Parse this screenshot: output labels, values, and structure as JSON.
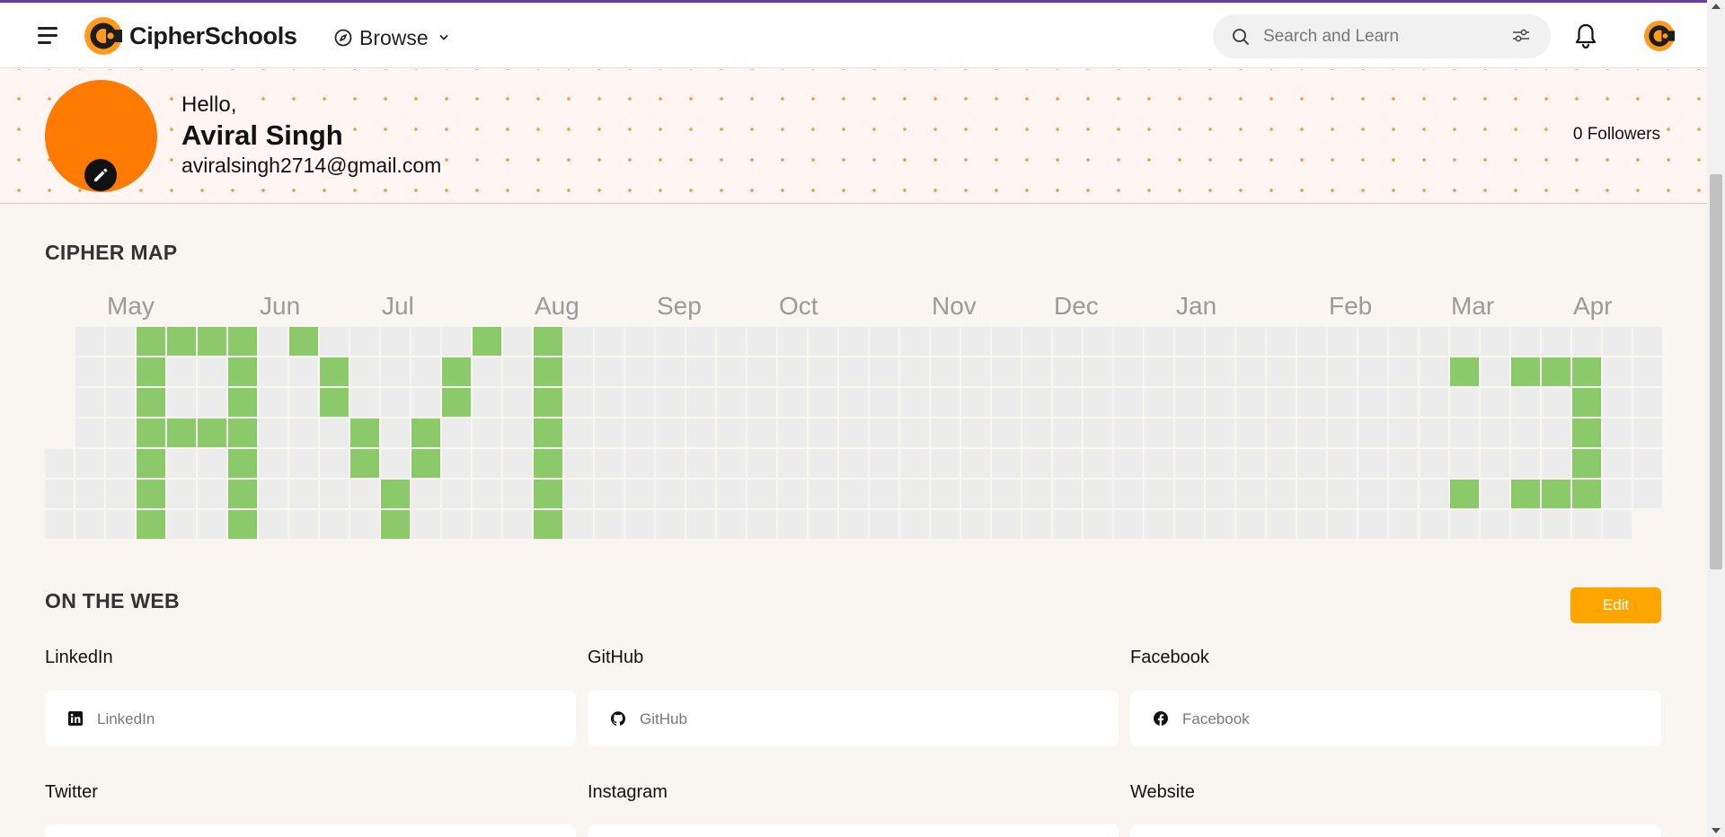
{
  "header": {
    "logo_text": "CipherSchools",
    "browse_label": "Browse",
    "search_placeholder": "Search and Learn"
  },
  "profile": {
    "greeting": "Hello,",
    "name": "Aviral Singh",
    "email": "aviralsingh2714@gmail.com",
    "followers": "0 Followers"
  },
  "cipher_map": {
    "title": "CIPHER MAP",
    "months": [
      "May",
      "Jun",
      "Jul",
      "Aug",
      "Sep",
      "Oct",
      "Nov",
      "Dec",
      "Jan",
      "Feb",
      "Mar",
      "Apr"
    ],
    "weeks": 53,
    "first_week_start_day": 4,
    "last_week_end_day": 5,
    "active": [
      [
        3,
        0
      ],
      [
        4,
        0
      ],
      [
        5,
        0
      ],
      [
        6,
        0
      ],
      [
        8,
        0
      ],
      [
        14,
        0
      ],
      [
        16,
        0
      ],
      [
        3,
        1
      ],
      [
        6,
        1
      ],
      [
        9,
        1
      ],
      [
        13,
        1
      ],
      [
        16,
        1
      ],
      [
        46,
        1
      ],
      [
        48,
        1
      ],
      [
        49,
        1
      ],
      [
        50,
        1
      ],
      [
        3,
        2
      ],
      [
        6,
        2
      ],
      [
        9,
        2
      ],
      [
        13,
        2
      ],
      [
        16,
        2
      ],
      [
        50,
        2
      ],
      [
        3,
        3
      ],
      [
        4,
        3
      ],
      [
        5,
        3
      ],
      [
        6,
        3
      ],
      [
        10,
        3
      ],
      [
        12,
        3
      ],
      [
        16,
        3
      ],
      [
        50,
        3
      ],
      [
        3,
        4
      ],
      [
        6,
        4
      ],
      [
        10,
        4
      ],
      [
        12,
        4
      ],
      [
        16,
        4
      ],
      [
        50,
        4
      ],
      [
        3,
        5
      ],
      [
        6,
        5
      ],
      [
        11,
        5
      ],
      [
        16,
        5
      ],
      [
        46,
        5
      ],
      [
        48,
        5
      ],
      [
        49,
        5
      ],
      [
        50,
        5
      ],
      [
        3,
        6
      ],
      [
        6,
        6
      ],
      [
        11,
        6
      ],
      [
        16,
        6
      ]
    ],
    "colors": {
      "active": "#8bc96a",
      "inactive": "#ececec"
    }
  },
  "on_the_web": {
    "title": "ON THE WEB",
    "edit_label": "Edit",
    "fields": [
      {
        "label": "LinkedIn",
        "placeholder": "LinkedIn",
        "icon": "linkedin-icon"
      },
      {
        "label": "GitHub",
        "placeholder": "GitHub",
        "icon": "github-icon"
      },
      {
        "label": "Facebook",
        "placeholder": "Facebook",
        "icon": "facebook-icon"
      },
      {
        "label": "Twitter",
        "placeholder": "",
        "icon": "twitter-icon"
      },
      {
        "label": "Instagram",
        "placeholder": "",
        "icon": "instagram-icon"
      },
      {
        "label": "Website",
        "placeholder": "",
        "icon": "globe-icon"
      }
    ]
  },
  "colors": {
    "accent": "#ffa500",
    "avatar": "#ff7a00",
    "brand_purple": "#6b3fa0"
  }
}
